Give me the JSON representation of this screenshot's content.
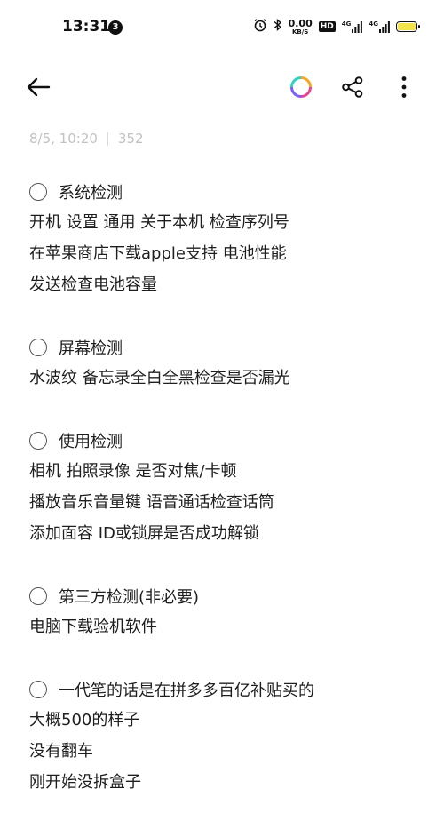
{
  "status_bar": {
    "time": "13:31",
    "notification_count": "3",
    "net_speed_value": "0.00",
    "net_speed_unit": "KB/S",
    "hd_label": "HD",
    "sim1_label": "4G",
    "sim2_label": "4G",
    "battery_color": "#f2e34a"
  },
  "toolbar": {
    "back_icon": "arrow-left-icon",
    "theme_icon": "color-ring-icon",
    "share_icon": "share-icon",
    "more_icon": "more-vertical-icon"
  },
  "note_meta": {
    "datetime": "8/5, 10:20",
    "char_count": "352"
  },
  "sections": [
    {
      "heading": "系统检测",
      "lines": [
        "开机 设置 通用 关于本机 检查序列号",
        "在苹果商店下载apple支持 电池性能",
        "发送检查电池容量"
      ]
    },
    {
      "heading": "屏幕检测",
      "lines": [
        "水波纹 备忘录全白全黑检查是否漏光"
      ]
    },
    {
      "heading": "使用检测",
      "lines": [
        "相机 拍照录像 是否对焦/卡顿",
        "播放音乐音量键 语音通话检查话筒",
        "添加面容 ID或锁屏是否成功解锁"
      ]
    },
    {
      "heading": "第三方检测(非必要)",
      "lines": [
        "电脑下载验机软件"
      ]
    },
    {
      "heading": "一代笔的话是在拼多多百亿补贴买的",
      "lines": [
        "大概500的样子",
        "没有翻车",
        "刚开始没拆盒子"
      ]
    }
  ]
}
